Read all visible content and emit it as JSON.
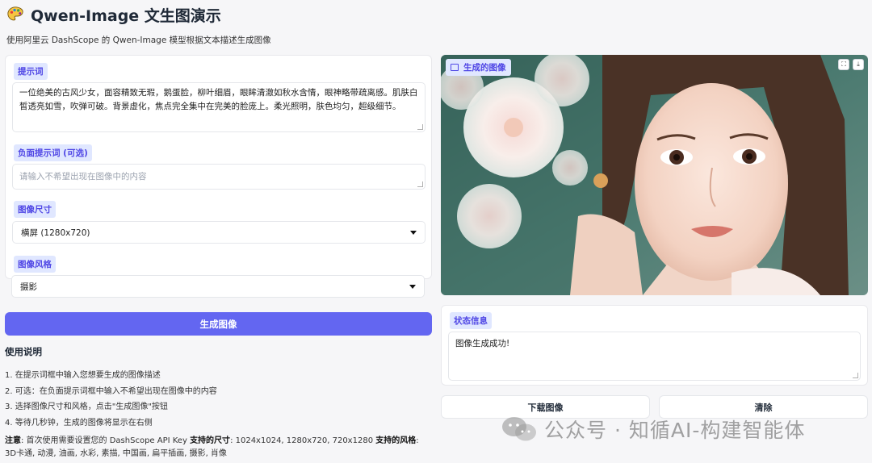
{
  "header": {
    "title": "Qwen-Image 文生图演示",
    "subtitle": "使用阿里云 DashScope 的 Qwen-Image 模型根据文本描述生成图像"
  },
  "form": {
    "prompt_label": "提示词",
    "prompt_value": "一位绝美的古风少女，面容精致无瑕，鹅蛋脸，柳叶细眉，眼眸清澈如秋水含情，眼神略带疏离感。肌肤白皙透亮如雪，吹弹可破。背景虚化，焦点完全集中在完美的脸庞上。柔光照明，肤色均匀，超级细节。",
    "negative_label": "负面提示词 (可选)",
    "negative_placeholder": "请输入不希望出现在图像中的内容",
    "size_label": "图像尺寸",
    "size_value": "横屏 (1280x720)",
    "style_label": "图像风格",
    "style_value": "摄影"
  },
  "generate_button": "生成图像",
  "instructions": {
    "title": "使用说明",
    "steps": [
      "1. 在提示词框中输入您想要生成的图像描述",
      "2. 可选：在负面提示词框中输入不希望出现在图像中的内容",
      "3. 选择图像尺寸和风格，点击\"生成图像\"按钮",
      "4. 等待几秒钟，生成的图像将显示在右侧"
    ],
    "note_label": "注意",
    "note_text": ": 首次使用需要设置您的 DashScope API Key ",
    "sizes_label": "支持的尺寸",
    "sizes_text": ": 1024x1024, 1280x720, 720x1280 ",
    "styles_label": "支持的风格",
    "styles_text": ": 3D卡通, 动漫, 油画, 水彩, 素描, 中国画, 扁平插画, 摄影, 肖像"
  },
  "output": {
    "image_label": "生成的图像",
    "fullscreen_icon": "expand-icon",
    "download_icon": "download-icon"
  },
  "status": {
    "label": "状态信息",
    "value": "图像生成成功!"
  },
  "actions": {
    "download": "下载图像",
    "clear": "清除"
  },
  "watermark": "公众号 · 知循AI-构建智能体",
  "colors": {
    "accent": "#6366f1",
    "label_bg": "#e0e7ff",
    "label_text": "#4f46e5"
  }
}
